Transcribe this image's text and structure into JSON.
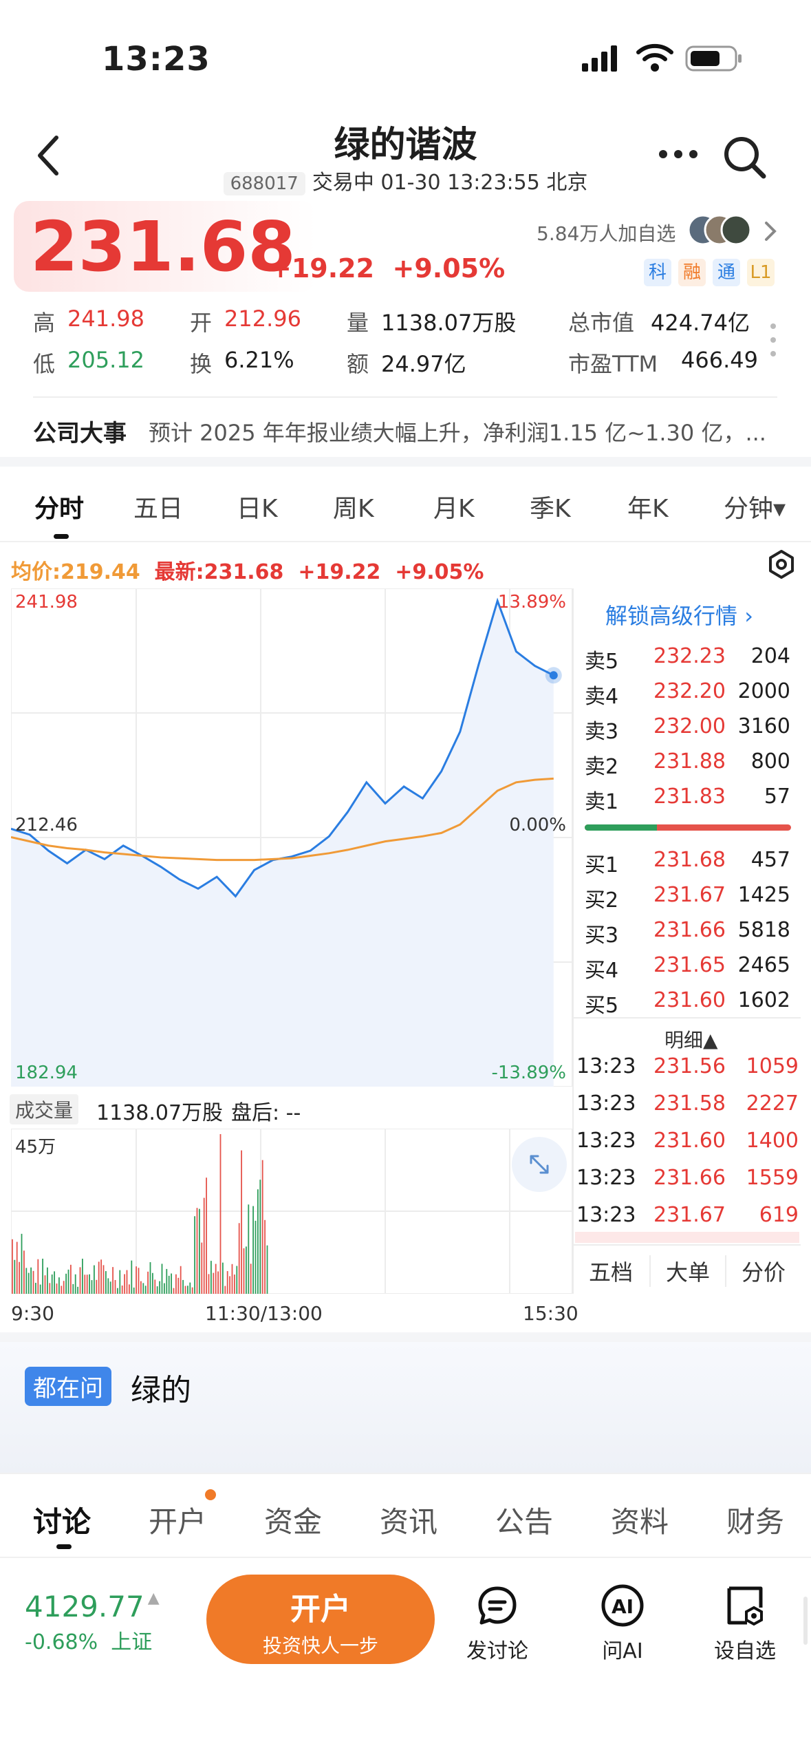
{
  "status_bar": {
    "time": "13:23"
  },
  "header": {
    "title": "绿的谐波",
    "code": "688017",
    "status_text": "交易中 01-30 13:23:55 北京"
  },
  "quote": {
    "price": "231.68",
    "change": "+19.22",
    "change_pct": "+9.05%",
    "followers": "5.84万人加自选",
    "tags": [
      "科",
      "融",
      "通",
      "L1"
    ],
    "colors": {
      "up": "#e53935",
      "down": "#2e9e5b",
      "avg": "#f09a37",
      "line": "#2a7de1"
    }
  },
  "stats": {
    "high_label": "高",
    "high": "241.98",
    "open_label": "开",
    "open": "212.96",
    "volume_label": "量",
    "volume": "1138.07万股",
    "mcap_label": "总市值",
    "mcap": "424.74亿",
    "low_label": "低",
    "low": "205.12",
    "turnover_label": "换",
    "turnover": "6.21%",
    "amount_label": "额",
    "amount": "24.97亿",
    "pe_label": "市盈TTM",
    "pe": "466.49"
  },
  "event": {
    "label": "公司大事",
    "text": "预计 2025 年年报业绩大幅上升，净利润1.15 亿~1.30 亿，..."
  },
  "period_tabs": [
    "分时",
    "五日",
    "日K",
    "周K",
    "月K",
    "季K",
    "年K",
    "分钟▾"
  ],
  "chart_header": {
    "avg": "均价:219.44",
    "latest": "最新:231.68",
    "change": "+19.22",
    "pct": "+9.05%"
  },
  "chart_labels": {
    "y_top": "241.98",
    "y_mid": "212.46",
    "y_bottom": "182.94",
    "pct_top": "13.89%",
    "pct_mid": "0.00%",
    "pct_bottom": "-13.89%",
    "volume_label": "成交量",
    "volume_value": "1138.07万股",
    "after_hours": "盘后: --",
    "vol_max": "45万",
    "t_start": "9:30",
    "t_mid": "11:30/13:00",
    "t_end": "15:30"
  },
  "chart_data": {
    "type": "line",
    "y_range": [
      182.94,
      241.98
    ],
    "series": [
      {
        "values": [
          213.5,
          212.8,
          210.9,
          209.4,
          211.0,
          209.9,
          211.5,
          210.3,
          209.0,
          207.5,
          206.4,
          207.8,
          205.5,
          208.6,
          209.8,
          210.2,
          210.9,
          212.6,
          215.5,
          219.0,
          216.5,
          218.5,
          217.1,
          220.3,
          225.0,
          233.0,
          240.5,
          234.5,
          232.8,
          231.68
        ]
      },
      {
        "values": [
          212.5,
          212.0,
          211.5,
          211.2,
          211.0,
          210.7,
          210.5,
          210.3,
          210.1,
          210.0,
          209.9,
          209.8,
          209.8,
          209.8,
          209.9,
          210.0,
          210.3,
          210.6,
          211.0,
          211.5,
          212.0,
          212.3,
          212.6,
          213.0,
          214.0,
          216.0,
          218.0,
          219.0,
          219.3,
          219.44
        ]
      }
    ]
  },
  "order_book": {
    "unlock": "解锁高级行情",
    "asks": [
      {
        "label": "卖5",
        "price": "232.23",
        "vol": "204"
      },
      {
        "label": "卖4",
        "price": "232.20",
        "vol": "2000"
      },
      {
        "label": "卖3",
        "price": "232.00",
        "vol": "3160"
      },
      {
        "label": "卖2",
        "price": "231.88",
        "vol": "800"
      },
      {
        "label": "卖1",
        "price": "231.83",
        "vol": "57"
      }
    ],
    "bids": [
      {
        "label": "买1",
        "price": "231.68",
        "vol": "457"
      },
      {
        "label": "买2",
        "price": "231.67",
        "vol": "1425"
      },
      {
        "label": "买3",
        "price": "231.66",
        "vol": "5818"
      },
      {
        "label": "买4",
        "price": "231.65",
        "vol": "2465"
      },
      {
        "label": "买5",
        "price": "231.60",
        "vol": "1602"
      }
    ],
    "bid_ratio": 0.35,
    "detail_label": "明细▲",
    "trades": [
      {
        "time": "13:23",
        "price": "231.56",
        "vol": "1059"
      },
      {
        "time": "13:23",
        "price": "231.58",
        "vol": "2227"
      },
      {
        "time": "13:23",
        "price": "231.60",
        "vol": "1400"
      },
      {
        "time": "13:23",
        "price": "231.66",
        "vol": "1559"
      },
      {
        "time": "13:23",
        "price": "231.67",
        "vol": "619"
      }
    ],
    "tabs": [
      "五档",
      "大单",
      "分价"
    ]
  },
  "ask_banner": {
    "tag": "都在问",
    "text": "绿的"
  },
  "bottom_tabs": [
    "讨论",
    "开户",
    "资金",
    "资讯",
    "公告",
    "资料",
    "财务"
  ],
  "bottom_bar": {
    "index_value": "4129.77",
    "index_change": "-0.68%",
    "index_name": "上证",
    "open_title": "开户",
    "open_sub": "投资快人一步",
    "discuss": "发讨论",
    "ai": "问AI",
    "watch": "设自选"
  }
}
